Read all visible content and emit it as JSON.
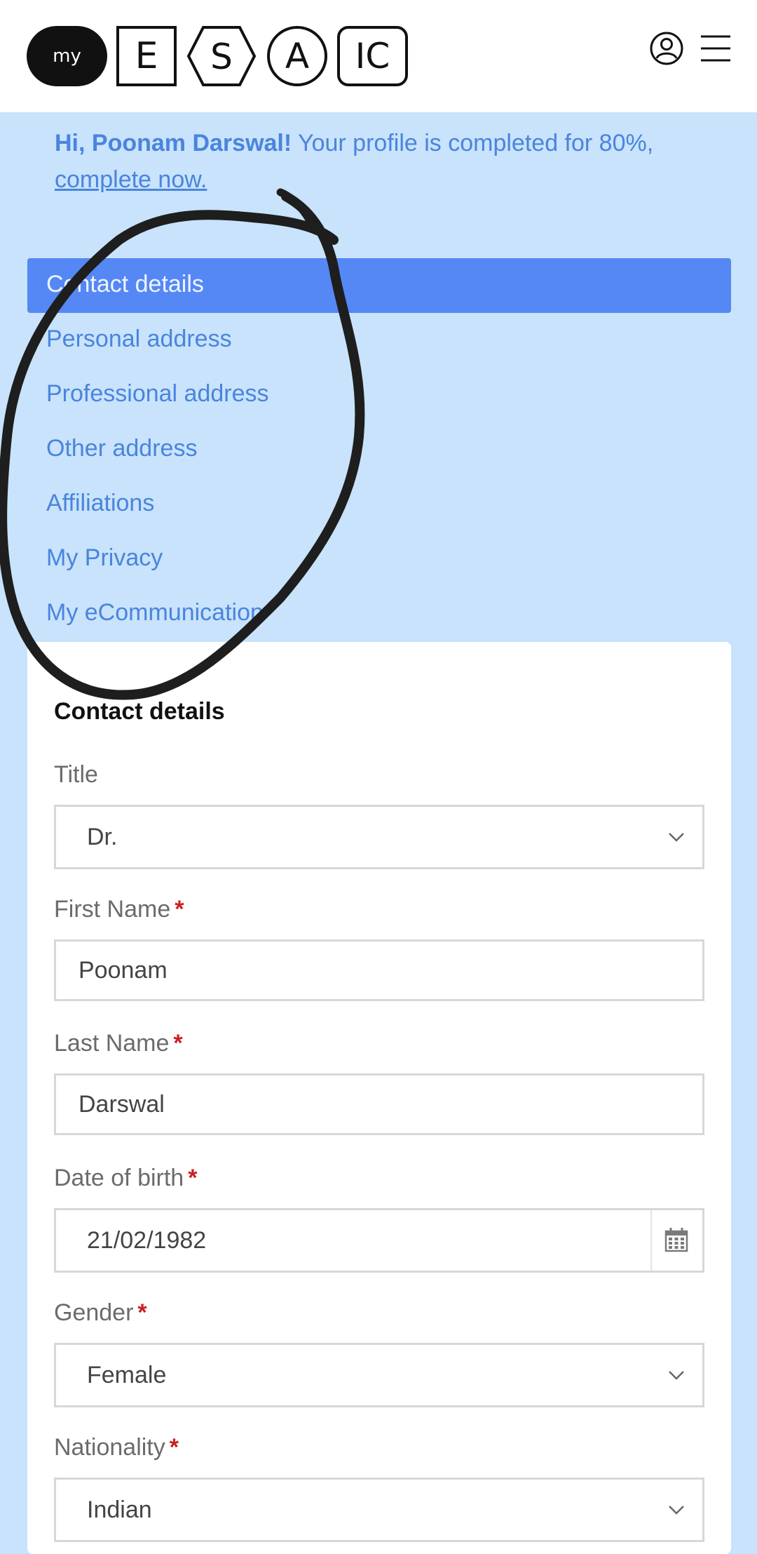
{
  "header": {
    "logo": {
      "my": "my",
      "e": "E",
      "s": "S",
      "a": "A",
      "ic": "IC"
    },
    "icons": [
      "user-circle-icon",
      "hamburger-menu-icon"
    ]
  },
  "greeting": {
    "name": "Hi, Poonam Darswal!",
    "message": " Your profile is completed for 80%,",
    "link": "complete now."
  },
  "nav": {
    "items": [
      {
        "label": "Contact details",
        "active": true
      },
      {
        "label": "Personal address"
      },
      {
        "label": "Professional address"
      },
      {
        "label": "Other address"
      },
      {
        "label": "Affiliations"
      },
      {
        "label": "My Privacy"
      },
      {
        "label": "My eCommunication"
      }
    ]
  },
  "form": {
    "title": "Contact details",
    "fields": {
      "title": {
        "label": "Title",
        "value": "Dr."
      },
      "first_name": {
        "label": "First Name",
        "value": "Poonam"
      },
      "last_name": {
        "label": "Last Name",
        "value": "Darswal"
      },
      "dob": {
        "label": "Date of birth",
        "value": "21/02/1982"
      },
      "gender": {
        "label": "Gender",
        "value": "Female"
      },
      "nationality": {
        "label": "Nationality",
        "value": "Indian"
      }
    },
    "required_mark": "*"
  },
  "colors": {
    "page_bg": "#c8e3fb",
    "accent": "#4a84dd",
    "active_nav": "#5588f5",
    "required": "#cc1f1f"
  }
}
